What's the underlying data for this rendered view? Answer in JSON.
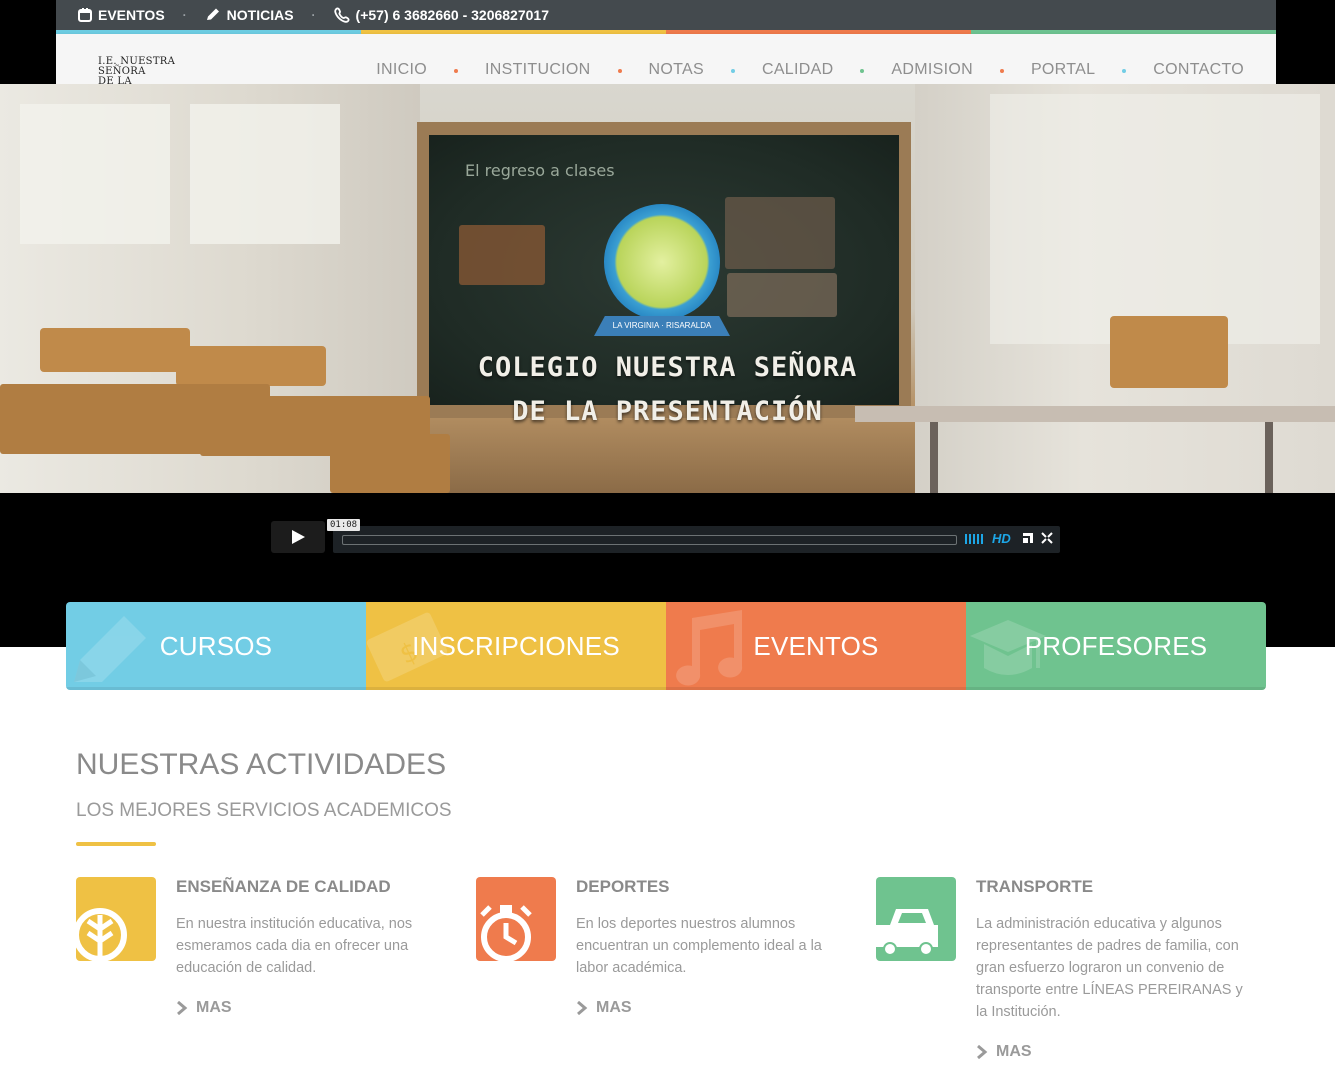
{
  "topbar": {
    "events_label": "EVENTOS",
    "news_label": "NOTICIAS",
    "phone": "(+57) 6 3682660 - 3206827017",
    "separator": "·"
  },
  "logo": {
    "line1": "I.E. NUESTRA SEÑORA",
    "line2": "DE LA PRESENTACION"
  },
  "nav": {
    "items": [
      {
        "label": "INICIO",
        "dot_color": "#ef7b4d"
      },
      {
        "label": "INSTITUCION",
        "dot_color": "#ef7b4d"
      },
      {
        "label": "NOTAS",
        "dot_color": "#72cde5"
      },
      {
        "label": "CALIDAD",
        "dot_color": "#6fc38f"
      },
      {
        "label": "ADMISION",
        "dot_color": "#ef7b4d"
      },
      {
        "label": "PORTAL",
        "dot_color": "#72cde5"
      },
      {
        "label": "CONTACTO"
      }
    ]
  },
  "video": {
    "title_line1": "COLEGIO NUESTRA SEÑORA",
    "title_line2": "DE LA PRESENTACIÓN",
    "board_heading": "El regreso a clases",
    "emblem_caption": "LA VIRGINIA · RISARALDA",
    "time": "01:08",
    "progress": 0,
    "quality": "HD"
  },
  "tiles": [
    {
      "label": "CURSOS",
      "icon": "pencil-icon",
      "color": "#72cde5"
    },
    {
      "label": "INSCRIPCIONES",
      "icon": "money-icon",
      "color": "#efc144"
    },
    {
      "label": "EVENTOS",
      "icon": "music-note-icon",
      "color": "#ef7b4d"
    },
    {
      "label": "PROFESORES",
      "icon": "graduation-cap-icon",
      "color": "#6fc38f"
    }
  ],
  "activities": {
    "title": "NUESTRAS ACTIVIDADES",
    "subtitle": "LOS MEJORES SERVICIOS ACADEMICOS",
    "accent_color": "#efc144",
    "more_label": "MAS",
    "items": [
      {
        "title": "ENSEÑANZA DE CALIDAD",
        "text": "En nuestra institución educativa, nos esmeramos cada dia en ofrecer una educación de calidad.",
        "icon": "leaf-icon",
        "color": "#efc144"
      },
      {
        "title": "DEPORTES",
        "text": "En los deportes nuestros alumnos encuentran un complemento ideal a la labor académica.",
        "icon": "stopwatch-icon",
        "color": "#ef7b4d"
      },
      {
        "title": "TRANSPORTE",
        "text": "La administración educativa y algunos representantes de padres de familia, con gran esfuerzo lograron un convenio de transporte entre LÍNEAS PEREIRANAS y la Institución.",
        "icon": "car-icon",
        "color": "#6fc38f"
      }
    ]
  }
}
